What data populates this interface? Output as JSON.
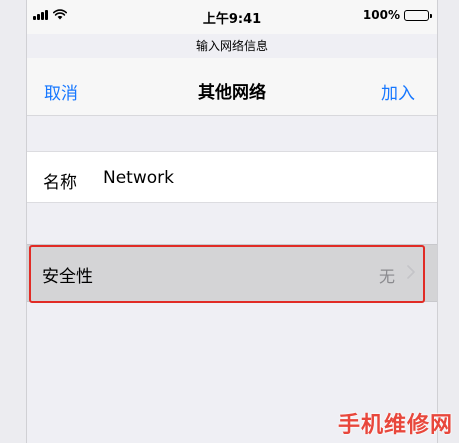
{
  "status_bar": {
    "time": "上午9:41",
    "battery": "100%"
  },
  "prompt": "输入网络信息",
  "nav": {
    "cancel": "取消",
    "title": "其他网络",
    "join": "加入"
  },
  "name_row": {
    "label": "名称",
    "value": "Network"
  },
  "security_row": {
    "label": "安全性",
    "value": "无"
  },
  "watermark": "手机维修网",
  "colors": {
    "accent": "#1677ff",
    "highlight": "#e12b25",
    "watermark": "#e8473c"
  }
}
